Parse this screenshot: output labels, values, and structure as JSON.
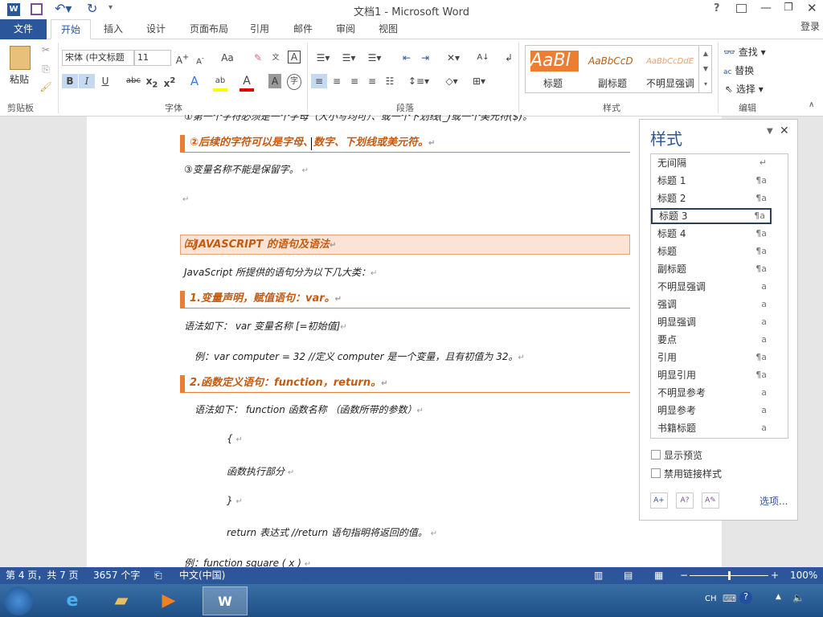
{
  "window": {
    "title": "文档1 - Microsoft Word",
    "signin": "登录"
  },
  "tabs": [
    "文件",
    "开始",
    "插入",
    "设计",
    "页面布局",
    "引用",
    "邮件",
    "审阅",
    "视图"
  ],
  "ribbon": {
    "clipboard": {
      "paste": "粘贴",
      "label": "剪贴板"
    },
    "font": {
      "name": "宋体 (中文标题",
      "size": "11",
      "label": "字体",
      "change_case": "Aa",
      "bold": "B",
      "italic": "I",
      "underline": "U",
      "strike": "abc"
    },
    "paragraph": {
      "label": "段落"
    },
    "styles": {
      "label": "样式",
      "gallery": [
        {
          "preview": "AaBl",
          "name": "标题"
        },
        {
          "preview": "AaBbCcD",
          "name": "副标题"
        },
        {
          "preview": "AaBbCcDdE",
          "name": "不明显强调"
        }
      ]
    },
    "editing": {
      "label": "编辑",
      "find": "查找",
      "replace": "替换",
      "select": "选择"
    }
  },
  "doc": {
    "l0": "①第一个字符必须是一个字母（大小写均可）、或一个下划线(_)或一个美元符($)。",
    "h1": "②后续的字符可以是字母、数字、下划线或美元符。",
    "l1": "③变量名称不能是保留字。",
    "h2": "㈤JAVASCRIPT 的语句及语法",
    "l2": "JavaScript 所提供的语句分为以下几大类：",
    "h3": "1.变量声明，赋值语句：var。",
    "l3": "语法如下：  var  变量名称  [=初始值]",
    "l4": "例：var computer = 32 //定义 computer 是一个变量，且有初值为 32。",
    "h4": "2.函数定义语句：function，return。",
    "l5": "语法如下：  function  函数名称  （函数所带的参数）",
    "l6": "{",
    "l7": "函数执行部分",
    "l8": "}",
    "l9": "return  表达式 //return 语句指明将返回的值。",
    "l10": "例：function square ( x )",
    "pilcrow": "↵"
  },
  "styles_pane": {
    "title": "样式",
    "items": [
      {
        "name": "无间隔",
        "mark": "↵"
      },
      {
        "name": "标题 1",
        "mark": "¶a"
      },
      {
        "name": "标题 2",
        "mark": "¶a"
      },
      {
        "name": "标题 3",
        "mark": "¶a"
      },
      {
        "name": "标题 4",
        "mark": "¶a"
      },
      {
        "name": "标题",
        "mark": "¶a"
      },
      {
        "name": "副标题",
        "mark": "¶a"
      },
      {
        "name": "不明显强调",
        "mark": "a"
      },
      {
        "name": "强调",
        "mark": "a"
      },
      {
        "name": "明显强调",
        "mark": "a"
      },
      {
        "name": "要点",
        "mark": "a"
      },
      {
        "name": "引用",
        "mark": "¶a"
      },
      {
        "name": "明显引用",
        "mark": "¶a"
      },
      {
        "name": "不明显参考",
        "mark": "a"
      },
      {
        "name": "明显参考",
        "mark": "a"
      },
      {
        "name": "书籍标题",
        "mark": "a"
      }
    ],
    "selected": "标题 3",
    "show_preview": "显示预览",
    "disable_linked": "禁用链接样式",
    "options": "选项..."
  },
  "status": {
    "page": "第 4 页，共 7 页",
    "words": "3657 个字",
    "language": "中文(中国)",
    "zoom": "100%",
    "zoom_percent": 100
  },
  "taskbar": {
    "ime": "CH"
  },
  "colors": {
    "accent": "#2b579a",
    "heading": "#ed7d31"
  }
}
